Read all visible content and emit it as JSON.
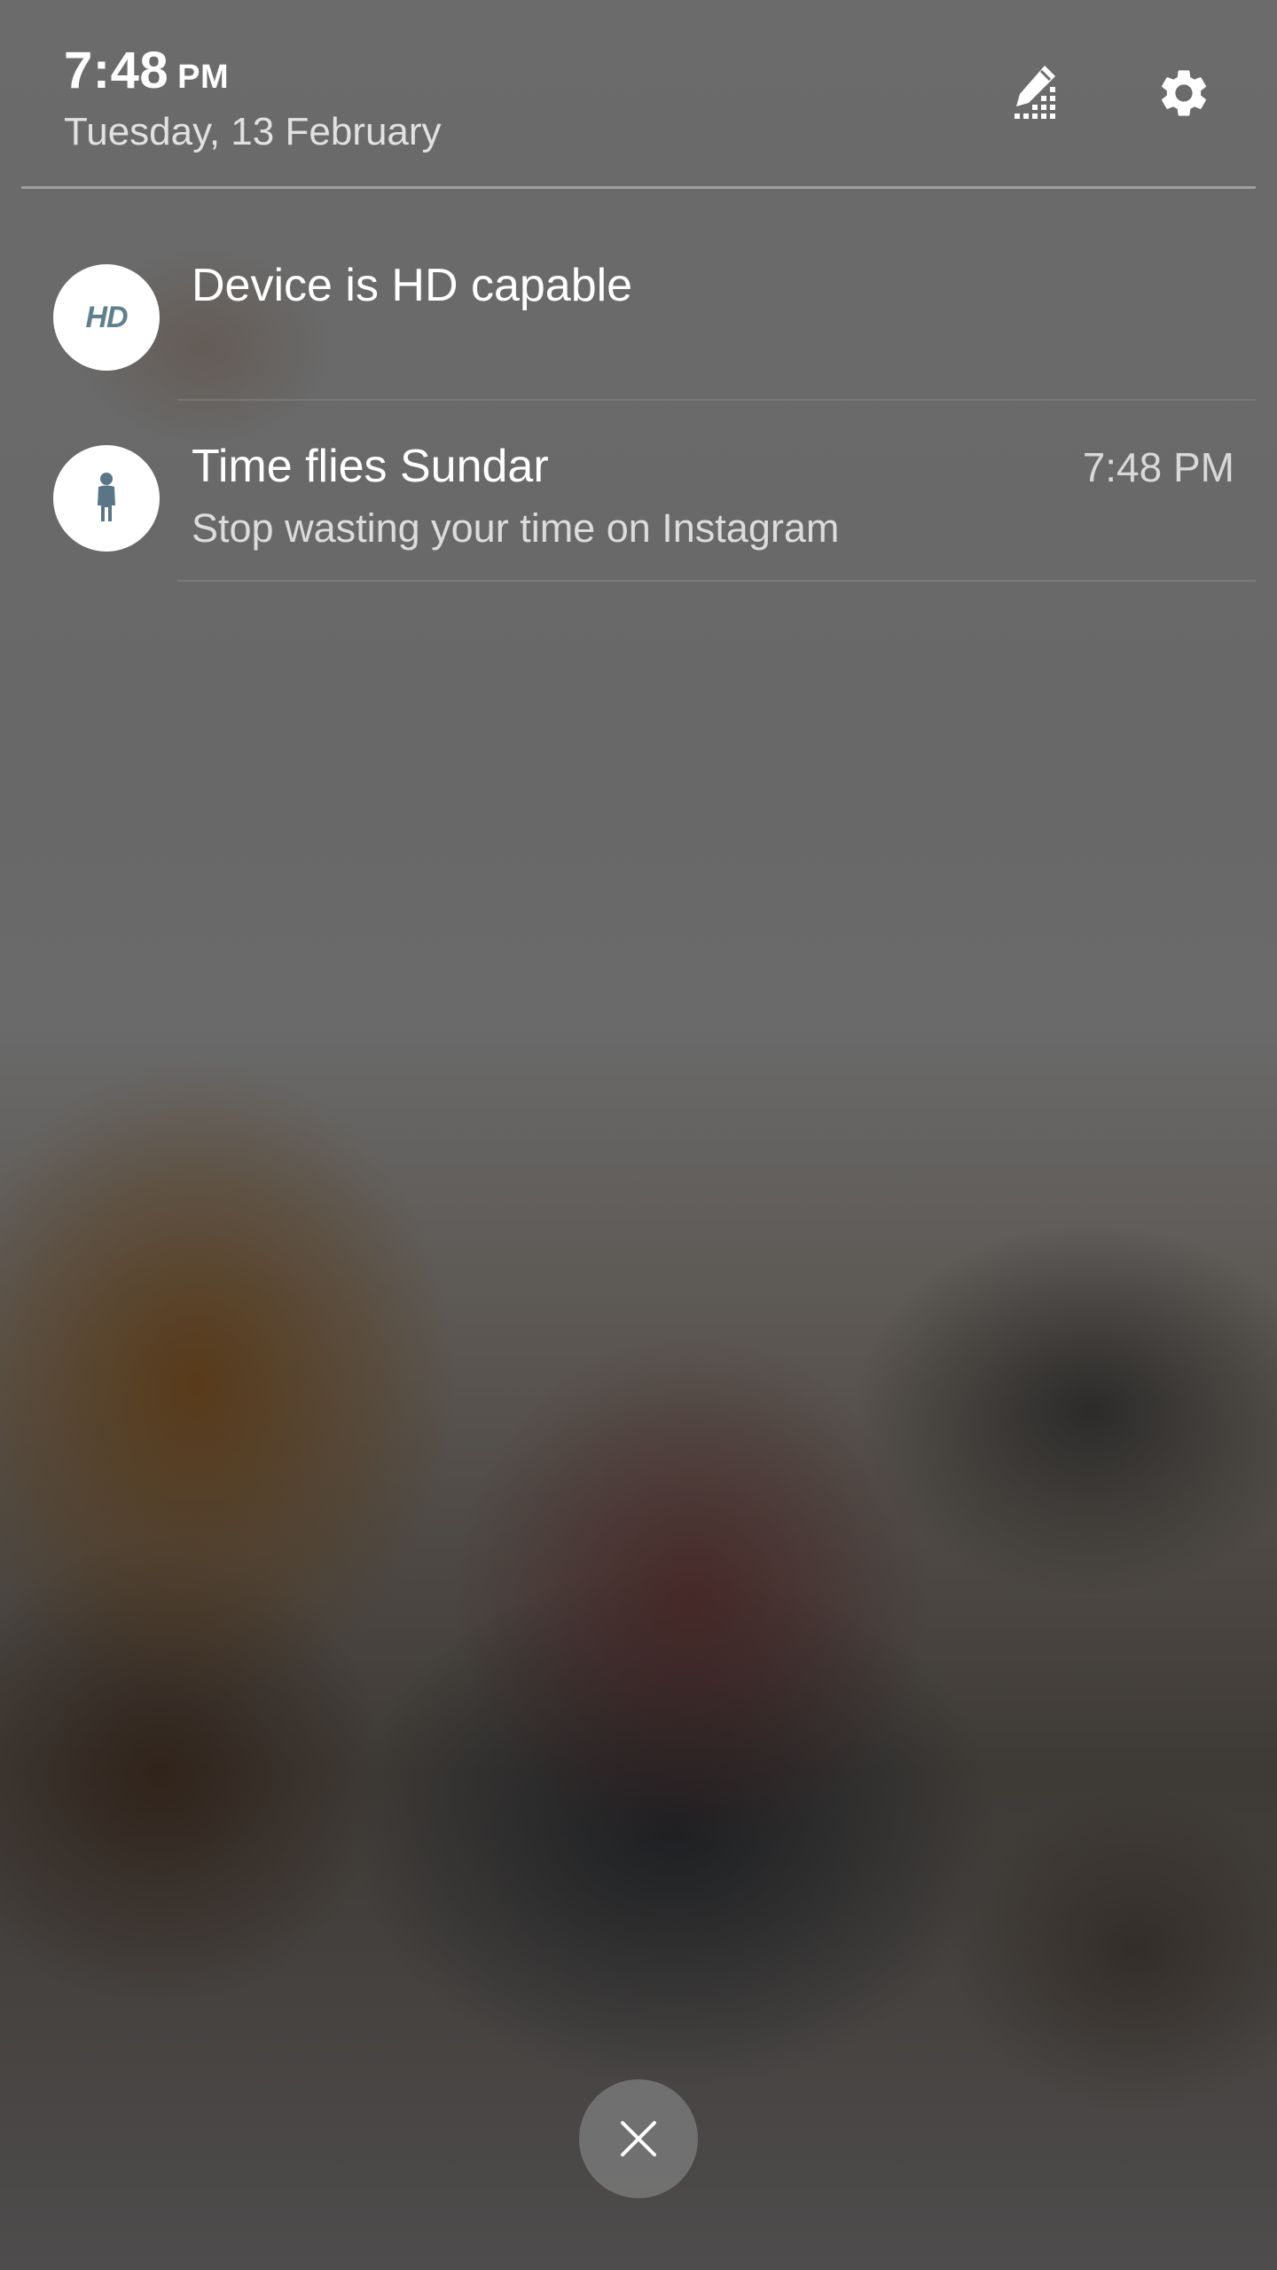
{
  "status": {
    "time": "7:48",
    "ampm": "PM",
    "date": "Tuesday, 13 February"
  },
  "header": {
    "edit_icon": "edit-brightness-icon",
    "settings_icon": "gear-icon"
  },
  "notifications": [
    {
      "icon": "hd-icon",
      "icon_text": "HD",
      "title": "Device is HD capable",
      "subtitle": "",
      "time": ""
    },
    {
      "icon": "person-icon",
      "title": "Time flies Sundar",
      "subtitle": "Stop wasting your time on Instagram",
      "time": "7:48 PM"
    }
  ],
  "controls": {
    "close_icon": "close-icon"
  },
  "colors": {
    "hd_icon": "#5f7f8f",
    "person_icon": "#5a7686",
    "text_primary": "#ffffff"
  }
}
